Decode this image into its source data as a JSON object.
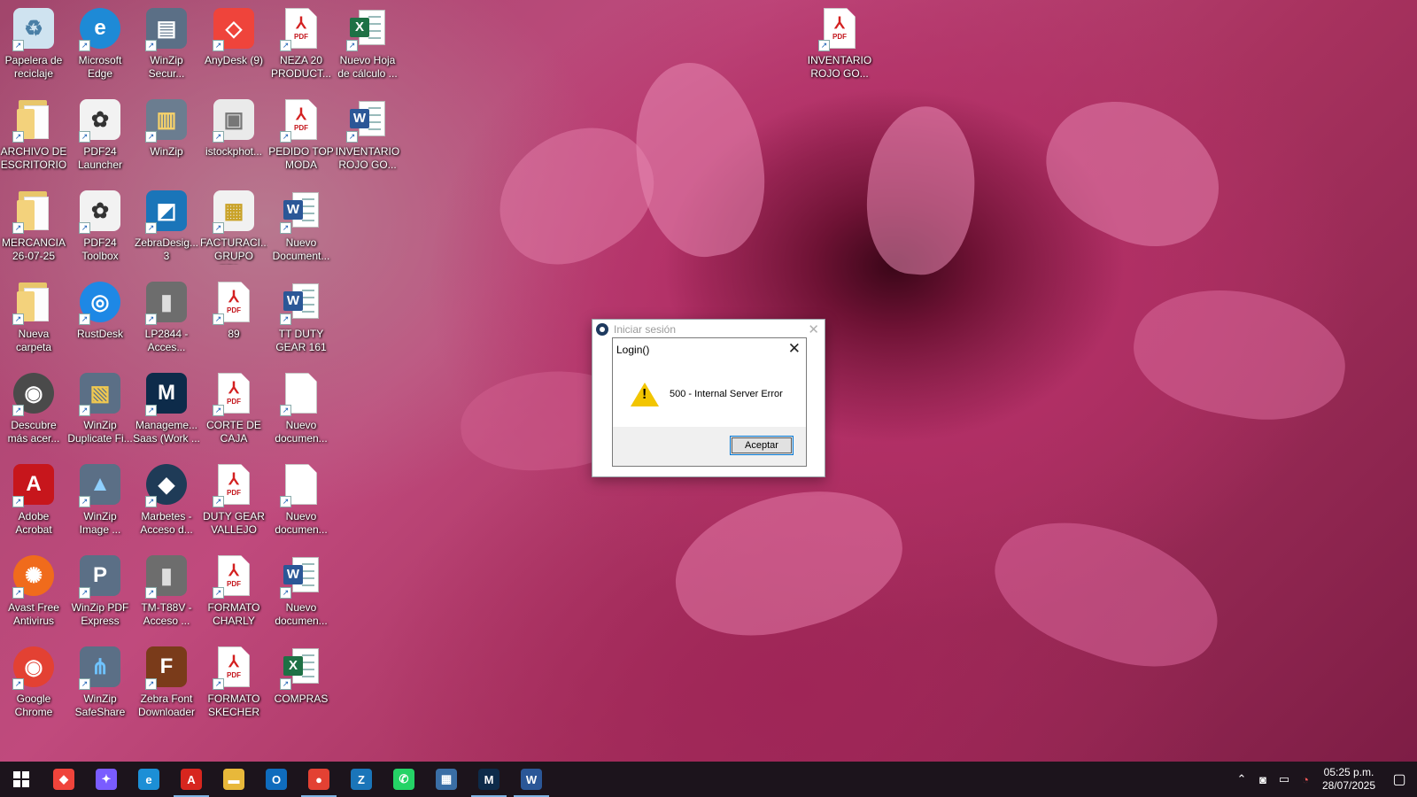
{
  "desktop": {
    "icons": [
      {
        "label": "Papelera de\nreciclaje",
        "icon": "recycle-bin-icon"
      },
      {
        "label": "Microsoft\nEdge",
        "icon": "edge-icon"
      },
      {
        "label": "WinZip\nSecur...",
        "icon": "winzip-secure-icon"
      },
      {
        "label": "AnyDesk (9)",
        "icon": "anydesk-icon"
      },
      {
        "label": "NEZA 20\nPRODUCT...",
        "icon": "pdf-file-icon",
        "tag": "PDF"
      },
      {
        "label": "Nuevo Hoja\nde cálculo ...",
        "icon": "excel-file-icon",
        "badge": "X"
      },
      {
        "label": "ARCHIVO DE\nESCRITORIO",
        "icon": "folder-icon"
      },
      {
        "label": "PDF24\nLauncher",
        "icon": "pdf24-launcher-icon"
      },
      {
        "label": "WinZip",
        "icon": "winzip-icon"
      },
      {
        "label": "istockphot...",
        "icon": "image-file-icon"
      },
      {
        "label": "PEDIDO TOP\nMODA",
        "icon": "pdf-file-icon",
        "tag": "PDF"
      },
      {
        "label": "INVENTARIO\nROJO GO...",
        "icon": "word-file-icon",
        "badge": "W"
      },
      {
        "label": "MERCANCIA\n26-07-25",
        "icon": "folder-icon"
      },
      {
        "label": "PDF24\nToolbox",
        "icon": "pdf24-toolbox-icon"
      },
      {
        "label": "ZebraDesig...\n3",
        "icon": "zebra-designer-icon"
      },
      {
        "label": "FACTURACI...\nGRUPO ETA...",
        "icon": "zip-file-icon"
      },
      {
        "label": "Nuevo\nDocument...",
        "icon": "word-file-icon",
        "badge": "W"
      },
      {
        "label": "Nueva\ncarpeta",
        "icon": "folder-icon"
      },
      {
        "label": "RustDesk",
        "icon": "rustdesk-icon"
      },
      {
        "label": "LP2844 -\nAcces...",
        "icon": "printer-icon"
      },
      {
        "label": "89",
        "icon": "pdf-file-icon",
        "tag": "PDF"
      },
      {
        "label": "TT DUTY\nGEAR 161",
        "icon": "word-file-icon",
        "badge": "W"
      },
      {
        "label": "Descubre\nmás acer...",
        "icon": "acer-icon"
      },
      {
        "label": "WinZip\nDuplicate Fi...",
        "icon": "winzip-duplicate-icon"
      },
      {
        "label": "Manageme...\nSaas (Work ...",
        "icon": "management-saas-icon"
      },
      {
        "label": "CORTE DE\nCAJA",
        "icon": "pdf-file-icon",
        "tag": "PDF"
      },
      {
        "label": "Nuevo\ndocumen...",
        "icon": "blank-document-icon"
      },
      {
        "label": "Adobe\nAcrobat",
        "icon": "adobe-acrobat-icon"
      },
      {
        "label": "WinZip\nImage ...",
        "icon": "winzip-image-icon"
      },
      {
        "label": "Marbetes -\nAcceso d...",
        "icon": "marbetes-icon"
      },
      {
        "label": "DUTY GEAR\nVALLEJO",
        "icon": "pdf-file-icon",
        "tag": "PDF"
      },
      {
        "label": "Nuevo\ndocumen...",
        "icon": "blank-document-icon"
      },
      {
        "label": "Avast Free\nAntivirus",
        "icon": "avast-icon"
      },
      {
        "label": "WinZip PDF\nExpress",
        "icon": "winzip-pdf-icon"
      },
      {
        "label": "TM-T88V -\nAcceso ...",
        "icon": "printer-icon"
      },
      {
        "label": "FORMATO\nCHARLY",
        "icon": "pdf-file-icon",
        "tag": "PDF"
      },
      {
        "label": "Nuevo\ndocumen...",
        "icon": "word-file-icon",
        "badge": "W"
      },
      {
        "label": "Google\nChrome",
        "icon": "chrome-icon"
      },
      {
        "label": "WinZip\nSafeShare",
        "icon": "winzip-safeshare-icon"
      },
      {
        "label": "Zebra Font\nDownloader",
        "icon": "zebra-font-icon"
      },
      {
        "label": "FORMATO\nSKECHER",
        "icon": "pdf-file-icon",
        "tag": "PDF"
      },
      {
        "label": "COMPRAS",
        "icon": "excel-file-icon",
        "badge": "X"
      },
      {
        "label": "INVENTARIO\nROJO GO...",
        "icon": "pdf-file-icon",
        "tag": "PDF"
      }
    ]
  },
  "dialog": {
    "window_title": "Iniciar sesión",
    "message_title": "Login()",
    "message": "500 - Internal Server Error",
    "ok_label": "Aceptar",
    "warning_symbol": "!"
  },
  "taskbar": {
    "apps": [
      {
        "name": "anydesk-taskbar-button",
        "glyph": "◆",
        "color": "#ef443b",
        "active": false
      },
      {
        "name": "copilot-taskbar-button",
        "glyph": "✦",
        "color": "#7a5cff",
        "active": false
      },
      {
        "name": "edge-taskbar-button",
        "glyph": "e",
        "color": "#1c8fd6",
        "active": false
      },
      {
        "name": "acrobat-taskbar-button",
        "glyph": "A",
        "color": "#d7261e",
        "active": true
      },
      {
        "name": "file-explorer-taskbar-button",
        "glyph": "▬",
        "color": "#e8b83a",
        "active": false
      },
      {
        "name": "outlook-taskbar-button",
        "glyph": "O",
        "color": "#0f6cbd",
        "active": false
      },
      {
        "name": "chrome-taskbar-button",
        "glyph": "●",
        "color": "#e34133",
        "active": true
      },
      {
        "name": "zebra-designer-taskbar-button",
        "glyph": "Z",
        "color": "#1a75b9",
        "active": false
      },
      {
        "name": "whatsapp-taskbar-button",
        "glyph": "✆",
        "color": "#25d366",
        "active": false
      },
      {
        "name": "calculator-taskbar-button",
        "glyph": "▦",
        "color": "#3a6ea5",
        "active": false
      },
      {
        "name": "management-saas-taskbar-button",
        "glyph": "M",
        "color": "#0d2b4a",
        "active": true
      },
      {
        "name": "word-taskbar-button",
        "glyph": "W",
        "color": "#2b5797",
        "active": true
      }
    ],
    "tray": {
      "time": "05:25 p.m.",
      "date": "28/07/2025"
    }
  },
  "colors": {
    "accent": "#0078d7",
    "taskbar_bg": "#1c141c",
    "warning": "#f2c500"
  }
}
